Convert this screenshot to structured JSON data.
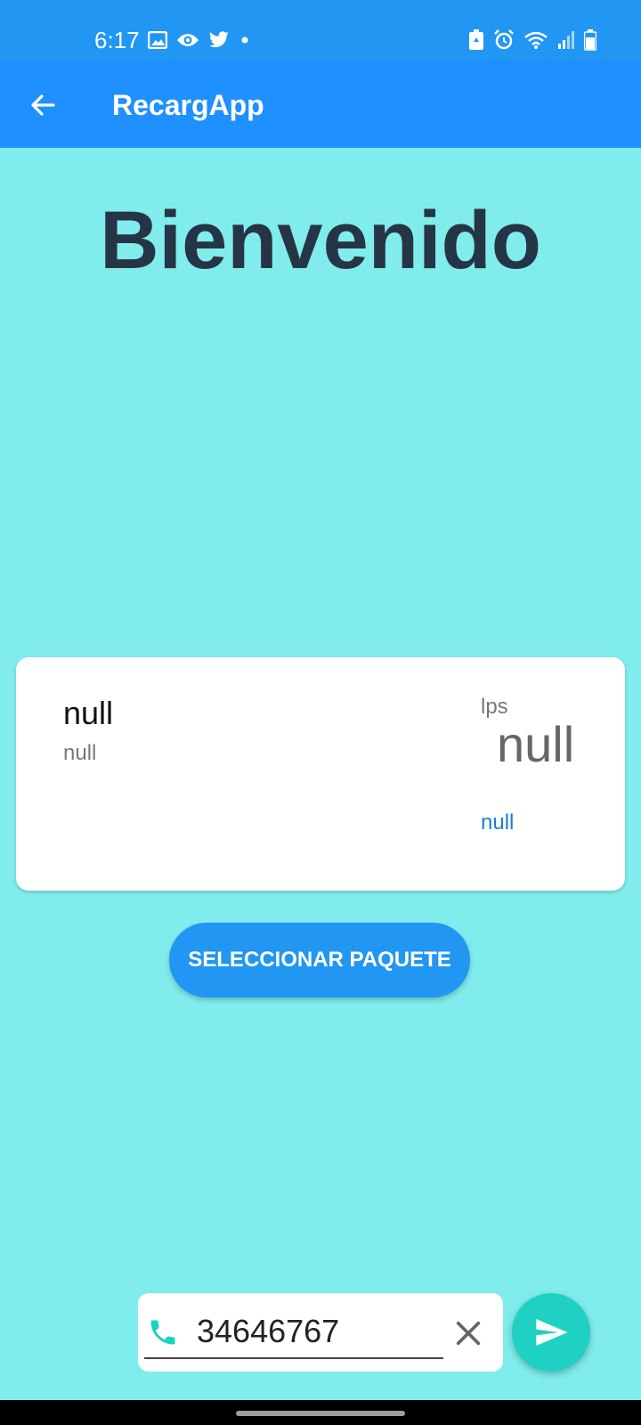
{
  "status_bar": {
    "time": "6:17",
    "left_icons": [
      "image-icon",
      "eye-icon",
      "twitter-icon",
      "dot-icon"
    ],
    "right_icons": [
      "battery-saver-icon",
      "alarm-icon",
      "wifi-icon",
      "signal-icon",
      "battery-icon"
    ]
  },
  "app_bar": {
    "title": "RecargApp",
    "back_icon": "arrow-back-icon"
  },
  "main": {
    "welcome": "Bienvenido"
  },
  "package_card": {
    "name": "null",
    "description": "null",
    "currency": "lps",
    "price": "null",
    "validity": "null"
  },
  "select_button": {
    "label": "SELECCIONAR PAQUETE"
  },
  "phone_input": {
    "value": "34646767",
    "icon": "phone-icon",
    "clear_icon": "close-icon"
  },
  "send_button": {
    "icon": "send-icon"
  },
  "colors": {
    "status_bar": "#2196F3",
    "app_bar": "#1E90FF",
    "background": "#80ECEC",
    "title_text": "#263545",
    "button": "#2196F3",
    "fab": "#1FD1C2",
    "phone_icon": "#1FD1C2",
    "validity_text": "#1E7ED4"
  }
}
